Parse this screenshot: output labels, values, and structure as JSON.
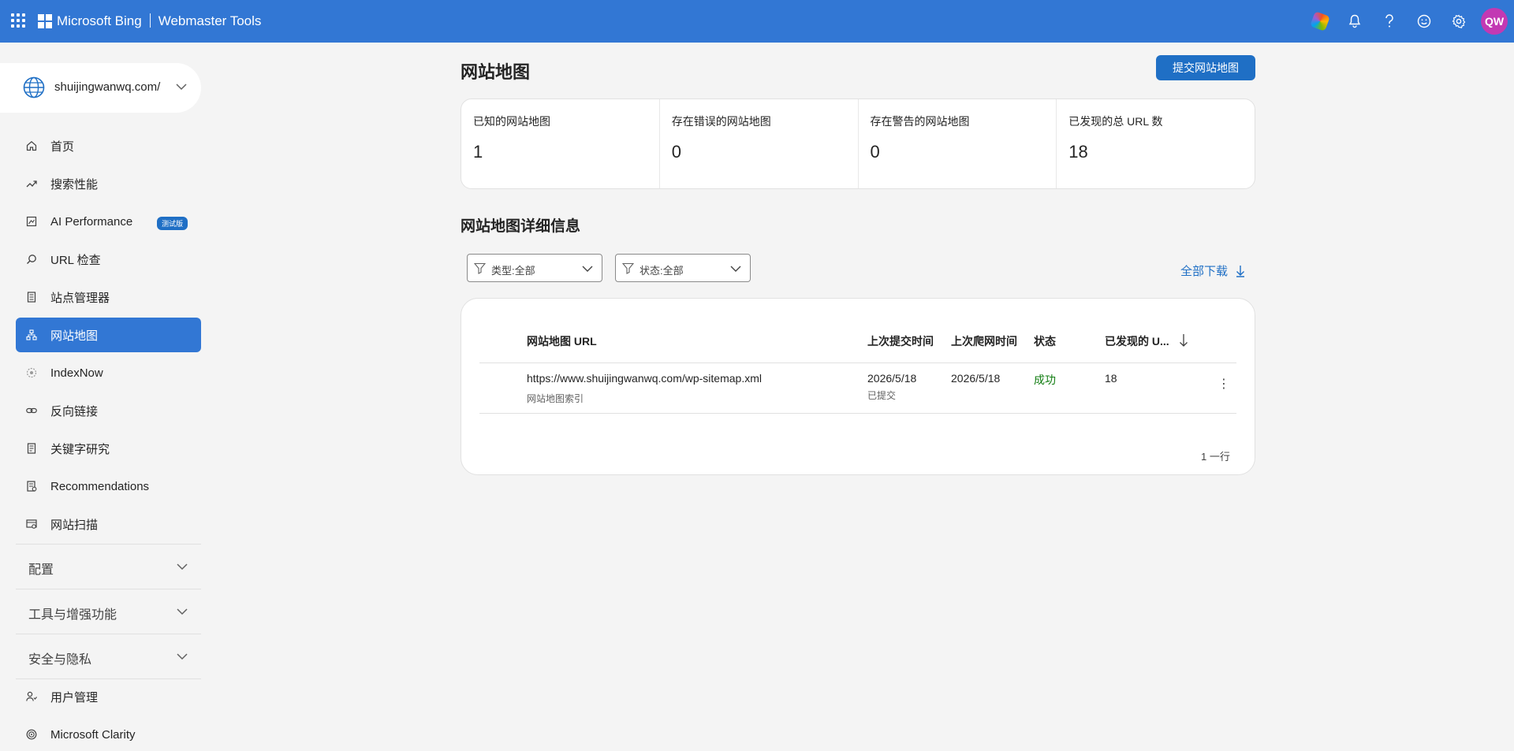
{
  "header": {
    "brand": "Microsoft Bing",
    "product": "Webmaster Tools",
    "avatar_initials": "QW",
    "icons": [
      "copilot-icon",
      "bell-icon",
      "help-icon",
      "feedback-icon",
      "settings-icon"
    ],
    "colors": {
      "bar": "#3277d4",
      "avatar": "#c239b3"
    }
  },
  "sidebar": {
    "site": "shuijingwanwq.com/",
    "items": [
      {
        "label": "首页",
        "icon": "home-icon"
      },
      {
        "label": "搜索性能",
        "icon": "trend-icon"
      },
      {
        "label": "AI Performance",
        "icon": "ai-chart-icon",
        "badge": "测试版"
      },
      {
        "label": "URL 检查",
        "icon": "search-icon"
      },
      {
        "label": "站点管理器",
        "icon": "document-icon"
      },
      {
        "label": "网站地图",
        "icon": "sitemap-icon",
        "active": true
      },
      {
        "label": "IndexNow",
        "icon": "indexnow-icon"
      },
      {
        "label": "反向链接",
        "icon": "link-icon"
      },
      {
        "label": "关键字研究",
        "icon": "keyword-icon"
      },
      {
        "label": "Recommendations",
        "icon": "recommendations-icon"
      },
      {
        "label": "网站扫描",
        "icon": "scan-icon"
      }
    ],
    "groups": [
      "配置",
      "工具与增强功能",
      "安全与隐私"
    ],
    "bottom_items": [
      {
        "label": "用户管理",
        "icon": "users-icon"
      },
      {
        "label": "Microsoft Clarity",
        "icon": "clarity-icon"
      }
    ]
  },
  "main": {
    "title": "网站地图",
    "submit_label": "提交网站地图",
    "stats": [
      {
        "label": "已知的网站地图",
        "value": "1"
      },
      {
        "label": "存在错误的网站地图",
        "value": "0"
      },
      {
        "label": "存在警告的网站地图",
        "value": "0"
      },
      {
        "label": "已发现的总 URL 数",
        "value": "18"
      }
    ],
    "section_title": "网站地图详细信息",
    "filters": {
      "type": "类型:全部",
      "status": "状态:全部"
    },
    "download_label": "全部下载",
    "table": {
      "columns": [
        "网站地图 URL",
        "上次提交时间",
        "上次爬网时间",
        "状态",
        "已发现的 U..."
      ],
      "rows": [
        {
          "url": "https://www.shuijingwanwq.com/wp-sitemap.xml",
          "url_sub": "网站地图索引",
          "submitted": "2026/5/18",
          "submitted_sub": "已提交",
          "crawled": "2026/5/18",
          "status": "成功",
          "discovered": "18"
        }
      ],
      "row_count": "1 一行"
    }
  }
}
